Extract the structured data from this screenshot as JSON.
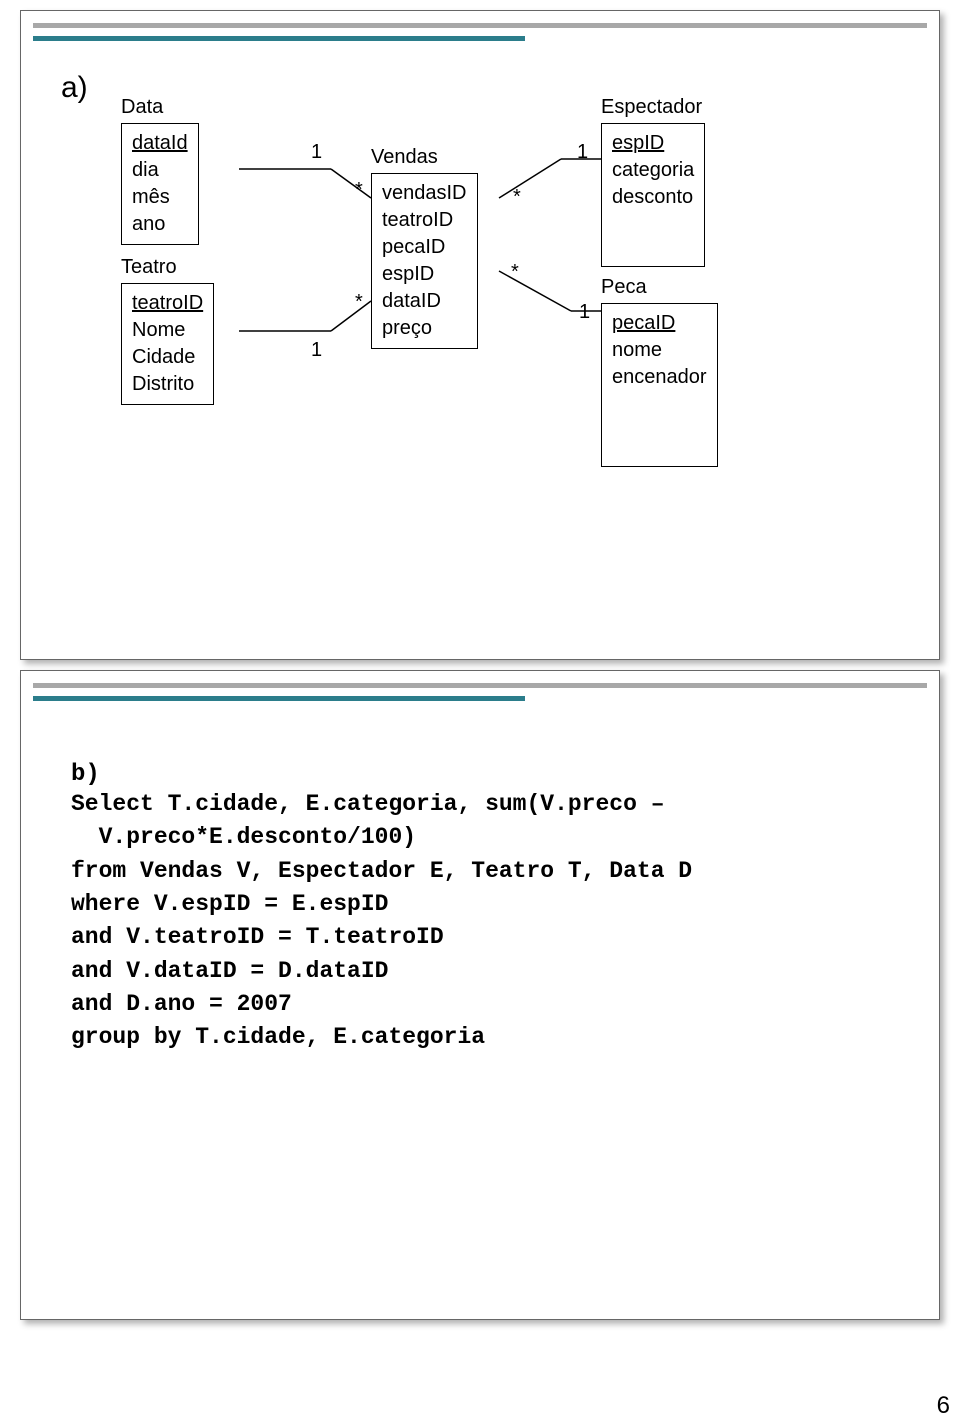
{
  "labels": {
    "a": "a)",
    "b": "b)"
  },
  "entities": {
    "data": {
      "title": "Data",
      "attrs": [
        "dataId",
        "dia",
        "mês",
        "ano"
      ],
      "keyIndex": 0
    },
    "teatro": {
      "title": "Teatro",
      "attrs": [
        "teatroID",
        "Nome",
        "Cidade",
        "Distrito"
      ],
      "keyIndex": 0
    },
    "vendas": {
      "title": "Vendas",
      "attrs": [
        "vendasID",
        "teatroID",
        "pecaID",
        "espID",
        "dataID",
        "preço"
      ]
    },
    "espectador": {
      "title": "Espectador",
      "attrs": [
        "espID",
        "categoria",
        "desconto"
      ],
      "keyIndex": 0
    },
    "peca": {
      "title": "Peca",
      "attrs": [
        "pecaID",
        "nome",
        "encenador"
      ],
      "keyIndex": 0
    }
  },
  "cardinalities": {
    "one": "1",
    "many": "*"
  },
  "sql": "Select T.cidade, E.categoria, sum(V.preco –\n  V.preco*E.desconto/100)\nfrom Vendas V, Espectador E, Teatro T, Data D\nwhere V.espID = E.espID\nand V.teatroID = T.teatroID\nand V.dataID = D.dataID\nand D.ano = 2007\ngroup by T.cidade, E.categoria",
  "pageNumber": "6",
  "chart_data": {
    "type": "table",
    "description": "Entity-Relationship diagram (star schema). Fact table Vendas links to dimensions Data, Teatro, Espectador, Peca. Cardinalities: Data 1—* Vendas, Teatro 1—* Vendas, Espectador 1—* Vendas, Peca 1—* Vendas.",
    "entities": [
      {
        "name": "Data",
        "attributes": [
          "dataId (PK)",
          "dia",
          "mês",
          "ano"
        ]
      },
      {
        "name": "Teatro",
        "attributes": [
          "teatroID (PK)",
          "Nome",
          "Cidade",
          "Distrito"
        ]
      },
      {
        "name": "Vendas",
        "attributes": [
          "vendasID",
          "teatroID",
          "pecaID",
          "espID",
          "dataID",
          "preço"
        ]
      },
      {
        "name": "Espectador",
        "attributes": [
          "espID (PK)",
          "categoria",
          "desconto"
        ]
      },
      {
        "name": "Peca",
        "attributes": [
          "pecaID (PK)",
          "nome",
          "encenador"
        ]
      }
    ],
    "relationships": [
      {
        "from": "Data",
        "to": "Vendas",
        "fromCard": "1",
        "toCard": "*"
      },
      {
        "from": "Teatro",
        "to": "Vendas",
        "fromCard": "1",
        "toCard": "*"
      },
      {
        "from": "Espectador",
        "to": "Vendas",
        "fromCard": "1",
        "toCard": "*"
      },
      {
        "from": "Peca",
        "to": "Vendas",
        "fromCard": "1",
        "toCard": "*"
      }
    ]
  }
}
